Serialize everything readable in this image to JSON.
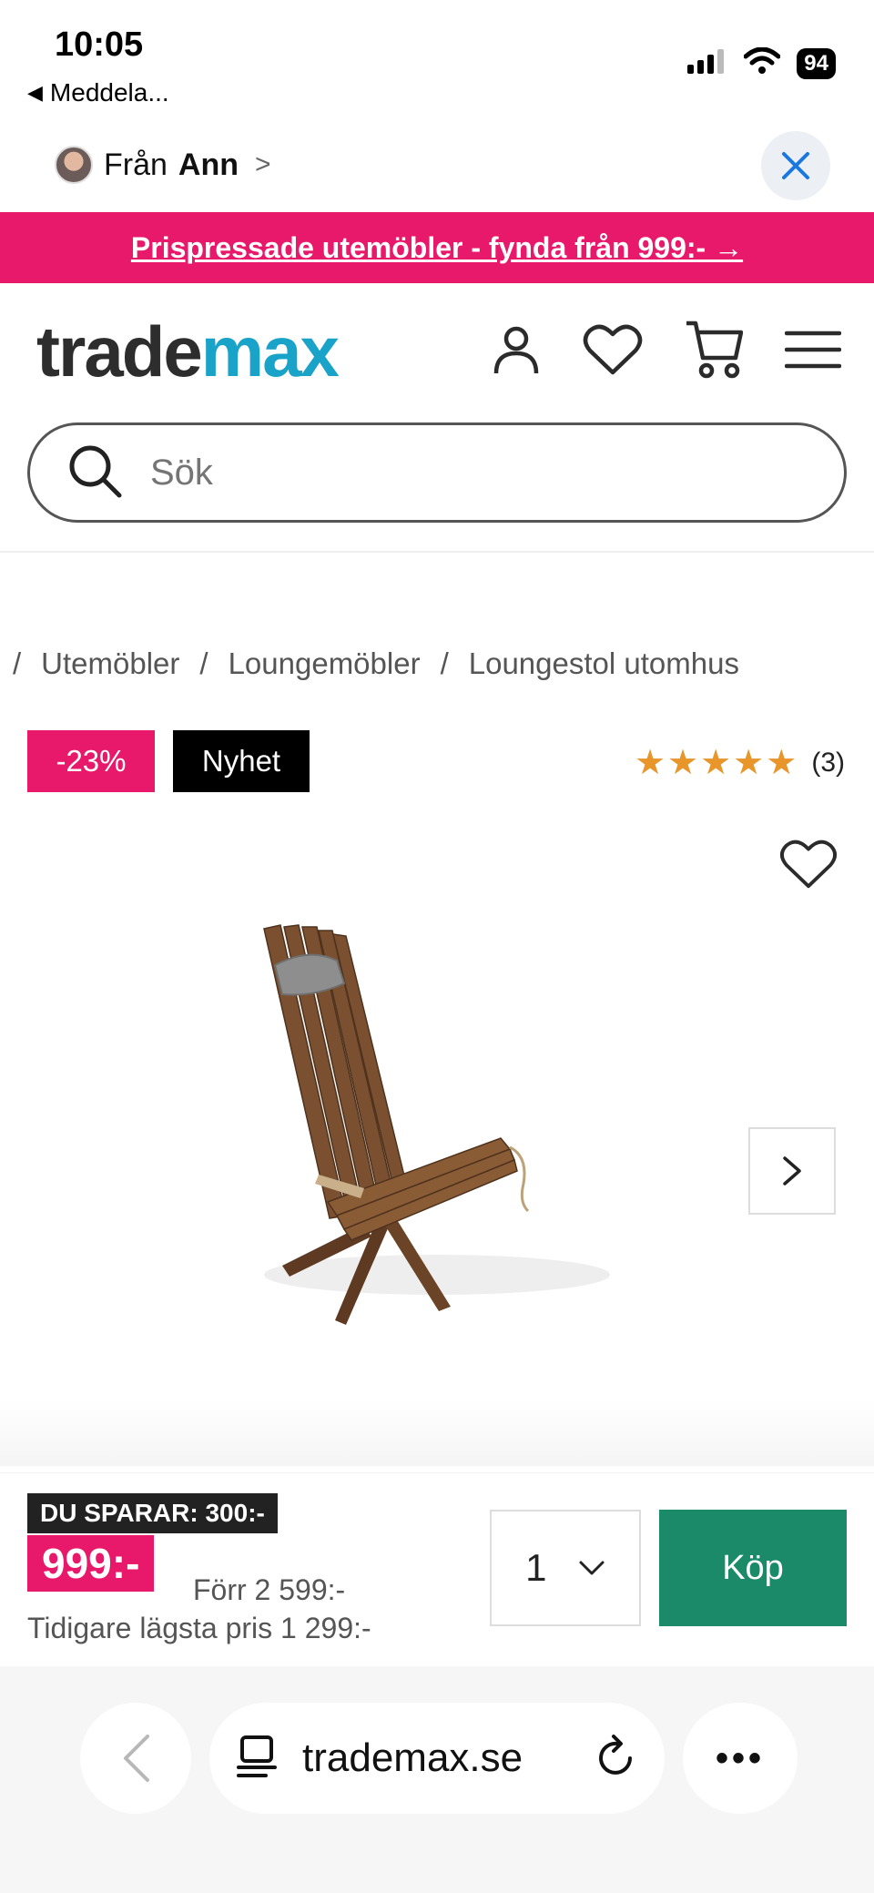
{
  "status_bar": {
    "time": "10:05",
    "back_app": "Meddela...",
    "battery": "94"
  },
  "share_bar": {
    "from_label": "Från",
    "from_name": "Ann"
  },
  "promo": {
    "text": "Prispressade utemöbler - fynda från 999:- →"
  },
  "header": {
    "logo_part1": "trade",
    "logo_part2": "max"
  },
  "search": {
    "placeholder": "Sök"
  },
  "breadcrumb": {
    "items": [
      "Utemöbler",
      "Loungemöbler",
      "Loungestol utomhus"
    ],
    "separator": "/"
  },
  "badges": {
    "discount": "-23%",
    "new": "Nyhet"
  },
  "rating": {
    "stars": 5,
    "count": "(3)"
  },
  "pricing": {
    "savings": "DU SPARAR: 300:-",
    "price": "999:-",
    "previous_price": "Förr 2 599:-",
    "lowest_price": "Tidigare lägsta pris 1 299:-"
  },
  "purchase": {
    "quantity": "1",
    "buy_label": "Köp"
  },
  "browser": {
    "url": "trademax.se"
  },
  "colors": {
    "brand_pink": "#e8196b",
    "brand_blue": "#1aa3c9",
    "buy_green": "#1b8a68",
    "star": "#e8952a"
  }
}
